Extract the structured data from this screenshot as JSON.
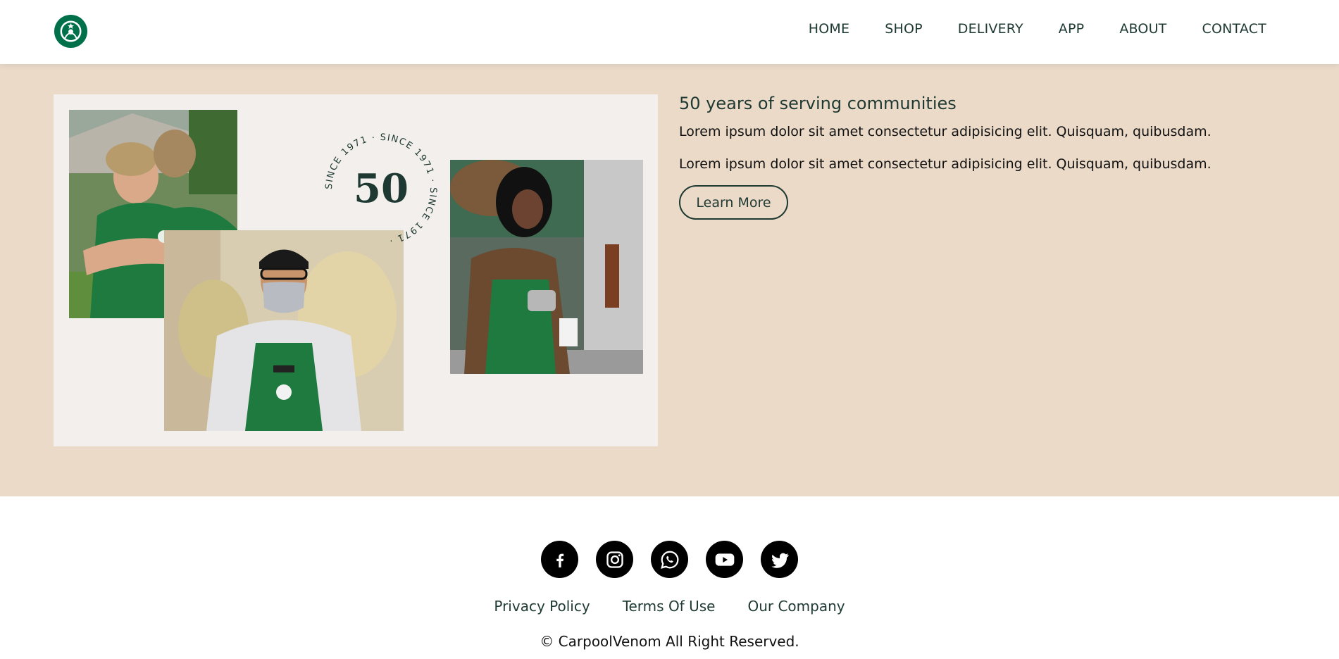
{
  "colors": {
    "brand_green": "#00704a",
    "dark_green": "#1e3932",
    "hero_bg": "#ebdac8",
    "collage_bg": "#f2efec"
  },
  "header": {
    "logo": "starbucks-logo",
    "nav": [
      {
        "label": "HOME"
      },
      {
        "label": "SHOP"
      },
      {
        "label": "DELIVERY"
      },
      {
        "label": "APP"
      },
      {
        "label": "ABOUT"
      },
      {
        "label": "CONTACT"
      }
    ]
  },
  "hero": {
    "badge": {
      "number": "50",
      "ring_text": "SINCE 1971 · SINCE 1971 · SINCE 1971 · "
    },
    "title": "50 years of serving communities",
    "paragraphs": [
      "Lorem ipsum dolor sit amet consectetur adipisicing elit. Quisquam, quibusdam.",
      "Lorem ipsum dolor sit amet consectetur adipisicing elit. Quisquam, quibusdam."
    ],
    "button_label": "Learn More"
  },
  "footer": {
    "socials": [
      {
        "icon": "facebook-icon"
      },
      {
        "icon": "instagram-icon"
      },
      {
        "icon": "whatsapp-icon"
      },
      {
        "icon": "youtube-icon"
      },
      {
        "icon": "twitter-icon"
      }
    ],
    "links": [
      {
        "label": "Privacy Policy"
      },
      {
        "label": "Terms Of Use"
      },
      {
        "label": "Our Company"
      }
    ],
    "copyright": "© CarpoolVenom All Right Reserved."
  }
}
